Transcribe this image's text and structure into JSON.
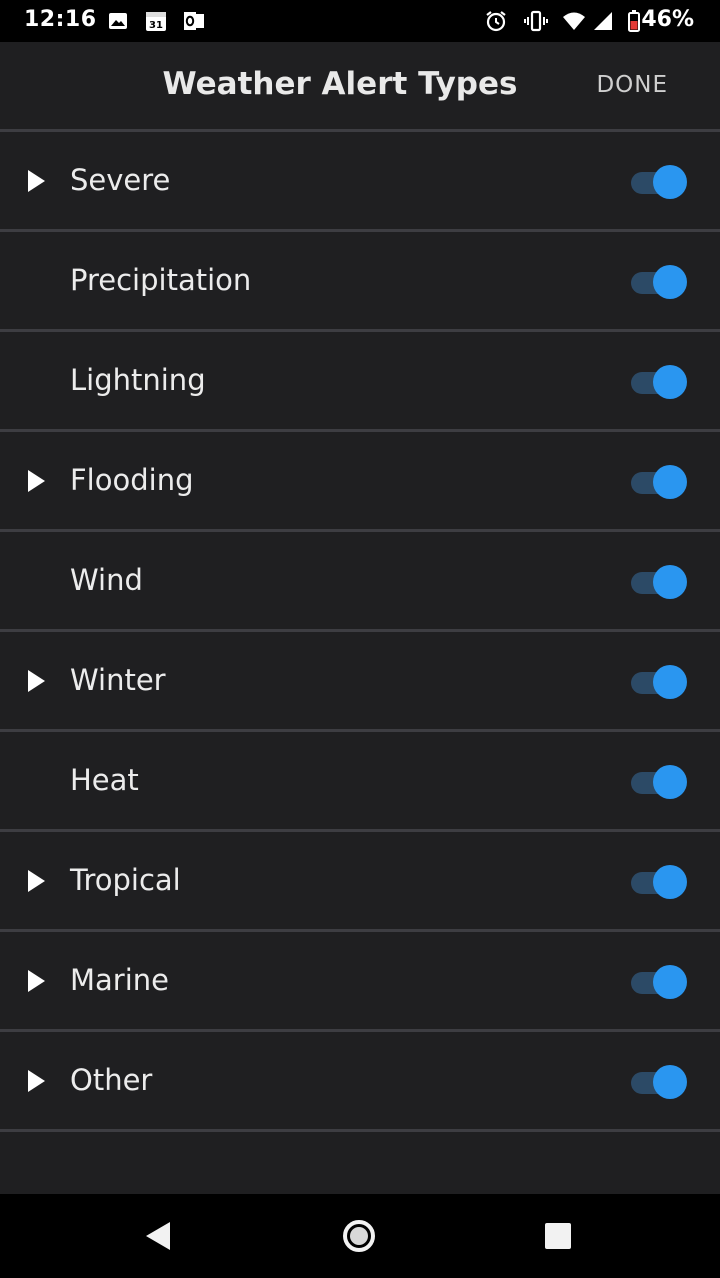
{
  "status_bar": {
    "time": "12:16",
    "battery_percent": "46%",
    "icons": [
      "image-notification-icon",
      "calendar-icon",
      "outlook-icon",
      "alarm-icon",
      "vibrate-icon",
      "wifi-icon",
      "signal-icon",
      "battery-icon"
    ],
    "calendar_day": "31"
  },
  "header": {
    "title": "Weather Alert Types",
    "done_label": "DONE"
  },
  "alert_types": [
    {
      "label": "Severe",
      "expandable": true,
      "enabled": true
    },
    {
      "label": "Precipitation",
      "expandable": false,
      "enabled": true
    },
    {
      "label": "Lightning",
      "expandable": false,
      "enabled": true
    },
    {
      "label": "Flooding",
      "expandable": true,
      "enabled": true
    },
    {
      "label": "Wind",
      "expandable": false,
      "enabled": true
    },
    {
      "label": "Winter",
      "expandable": true,
      "enabled": true
    },
    {
      "label": "Heat",
      "expandable": false,
      "enabled": true
    },
    {
      "label": "Tropical",
      "expandable": true,
      "enabled": true
    },
    {
      "label": "Marine",
      "expandable": true,
      "enabled": true
    },
    {
      "label": "Other",
      "expandable": true,
      "enabled": true
    }
  ],
  "nav_bar": {
    "buttons": [
      "back-icon",
      "home-icon",
      "recents-icon"
    ]
  },
  "colors": {
    "background": "#1f1f21",
    "divider": "#3d3d42",
    "toggle_on": "#2a96f0",
    "toggle_track": "#2c4a66"
  }
}
